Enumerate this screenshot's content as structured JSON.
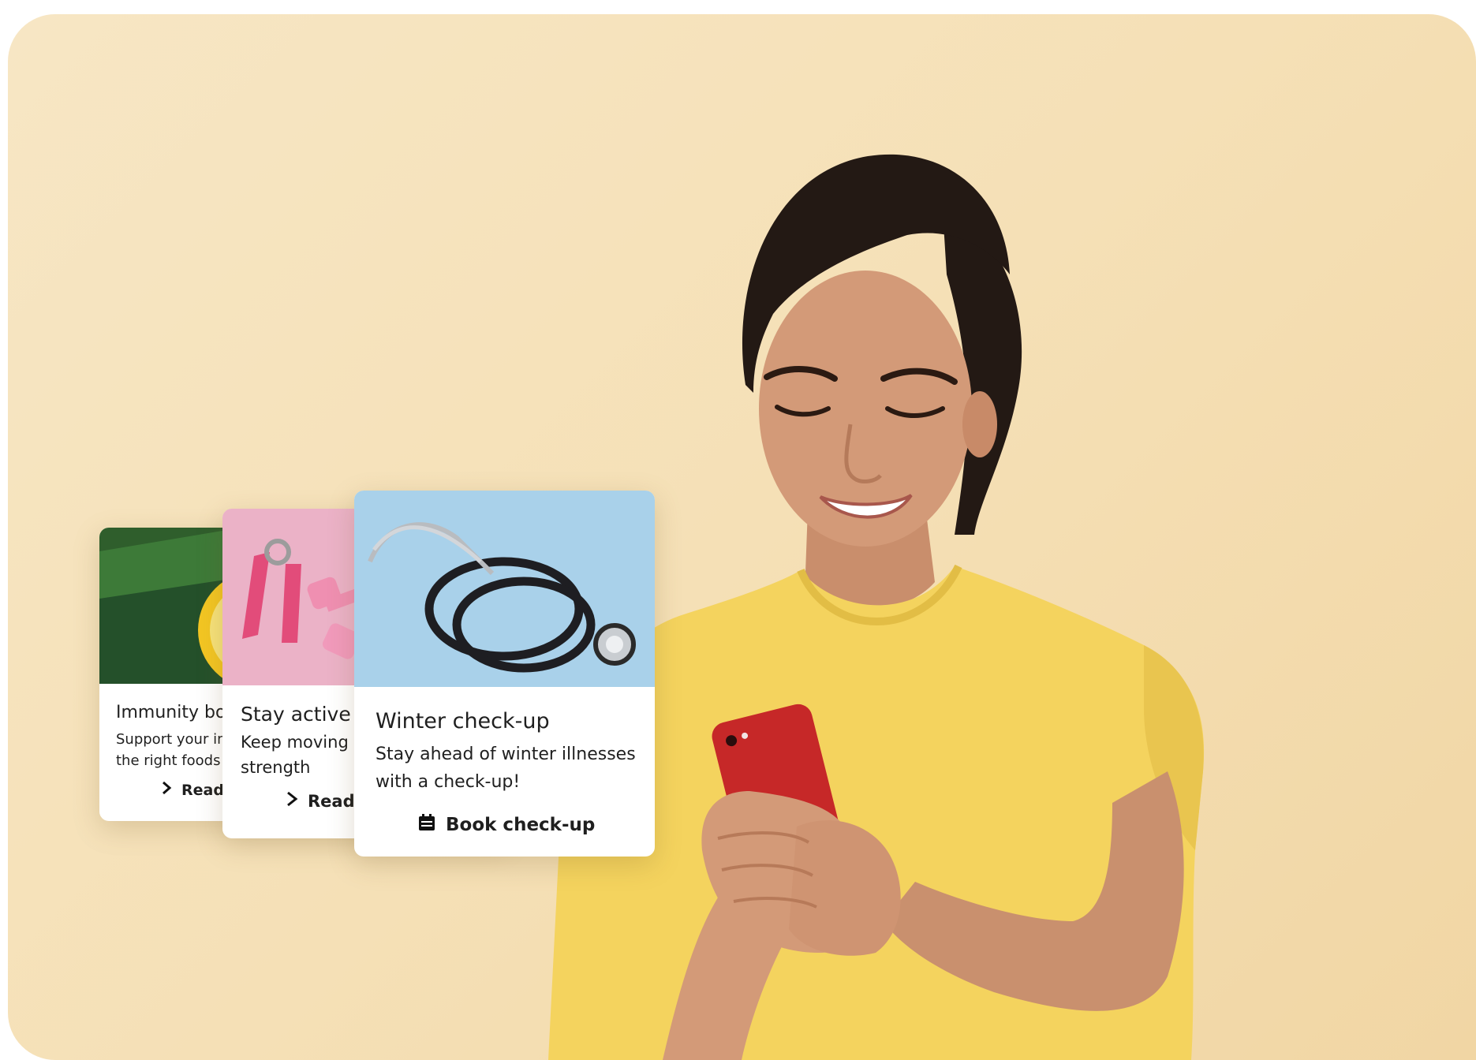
{
  "cards": [
    {
      "title": "Immunity boost",
      "description": "Support your immune system with the right foods",
      "action_label": "Read more",
      "action_icon": "chevron-right-icon",
      "image": "lemon-photo"
    },
    {
      "title": "Stay active",
      "description": "Keep moving daily for energy, strength",
      "action_label": "Read more",
      "action_icon": "chevron-right-icon",
      "image": "dumbbells-photo"
    },
    {
      "title": "Winter check-up",
      "description": "Stay ahead of winter illnesses with a check-up!",
      "action_label": "Book check-up",
      "action_icon": "calendar-icon",
      "image": "stethoscope-photo"
    }
  ],
  "colors": {
    "background": "#f6e2bb",
    "shirt": "#f4d35e",
    "phone": "#c62828",
    "hair": "#231914"
  }
}
